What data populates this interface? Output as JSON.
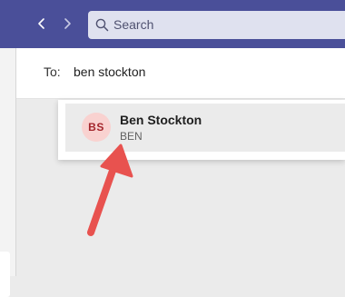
{
  "search": {
    "placeholder": "Search"
  },
  "compose": {
    "to_label": "To:",
    "to_value": "ben stockton"
  },
  "suggestion": {
    "initials": "BS",
    "name": "Ben Stockton",
    "subtitle": "BEN"
  },
  "colors": {
    "topbar": "#4a4f99",
    "avatar_bg": "#f9d2d0",
    "avatar_text": "#a4262c",
    "annotation_arrow": "#e8524f"
  }
}
